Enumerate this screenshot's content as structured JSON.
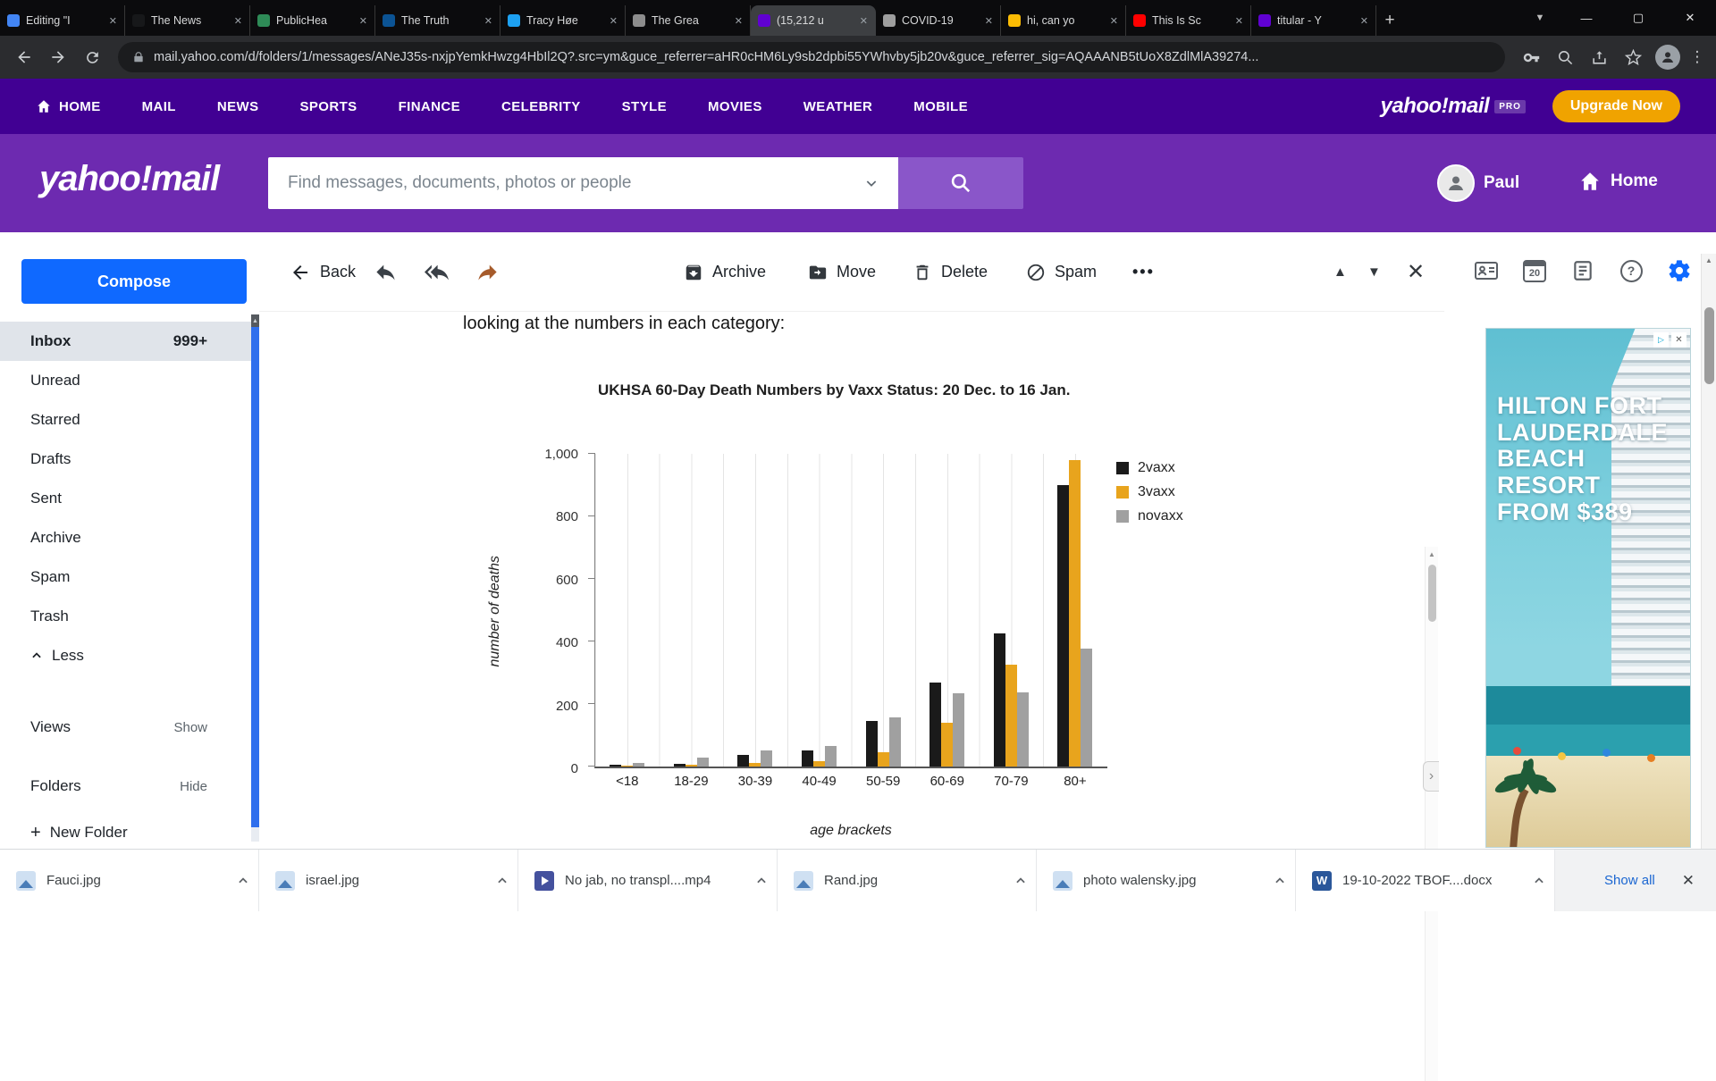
{
  "browser": {
    "tabs": [
      {
        "title": "Editing \"I",
        "color": "#4285f4",
        "active": false
      },
      {
        "title": "The News",
        "color": "#17181a",
        "active": false
      },
      {
        "title": "PublicHea",
        "color": "#2e8b57",
        "active": false
      },
      {
        "title": "The Truth",
        "color": "#0b5394",
        "active": false
      },
      {
        "title": "Tracy Høe",
        "color": "#1da1f2",
        "active": false
      },
      {
        "title": "The Grea",
        "color": "#8d8d8d",
        "active": false
      },
      {
        "title": "(15,212 u",
        "color": "#6001d2",
        "active": true
      },
      {
        "title": "COVID-19",
        "color": "#9e9e9e",
        "active": false
      },
      {
        "title": "hi, can yo",
        "color": "#fbbc04",
        "active": false
      },
      {
        "title": "This Is Sc",
        "color": "#ff0000",
        "active": false
      },
      {
        "title": "titular - Y",
        "color": "#6001d2",
        "active": false
      }
    ],
    "url": "mail.yahoo.com/d/folders/1/messages/ANeJ35s-nxjpYemkHwzg4HbIl2Q?.src=ym&guce_referrer=aHR0cHM6Ly9sb2dpbi55YWhvby5jb20v&guce_referrer_sig=AQAAANB5tUoX8ZdlMlA39274..."
  },
  "yahoo_nav": {
    "items": [
      "HOME",
      "MAIL",
      "NEWS",
      "SPORTS",
      "FINANCE",
      "CELEBRITY",
      "STYLE",
      "MOVIES",
      "WEATHER",
      "MOBILE"
    ],
    "active": "MAIL",
    "brand": "yahoo!mail",
    "brand_badge": "PRO",
    "upgrade_label": "Upgrade Now"
  },
  "header": {
    "logo": "yahoo!mail",
    "search_placeholder": "Find messages, documents, photos or people",
    "user_name": "Paul",
    "home_label": "Home"
  },
  "sidebar": {
    "compose_label": "Compose",
    "folders": [
      {
        "label": "Inbox",
        "count": "999+",
        "selected": true
      },
      {
        "label": "Unread"
      },
      {
        "label": "Starred"
      },
      {
        "label": "Drafts"
      },
      {
        "label": "Sent"
      },
      {
        "label": "Archive"
      },
      {
        "label": "Spam"
      },
      {
        "label": "Trash"
      },
      {
        "label": "Less",
        "icon": "chevron-up"
      }
    ],
    "sections": [
      {
        "label": "Views",
        "action": "Show"
      },
      {
        "label": "Folders",
        "action": "Hide"
      },
      {
        "label": "New Folder"
      }
    ]
  },
  "toolbar": {
    "back_label": "Back",
    "actions": [
      {
        "label": "Archive"
      },
      {
        "label": "Move"
      },
      {
        "label": "Delete"
      },
      {
        "label": "Spam"
      }
    ],
    "more": "•••"
  },
  "rail": {
    "calendar_count": "20"
  },
  "email": {
    "intro_text": "looking at the numbers in each category:"
  },
  "chart_data": {
    "type": "bar",
    "title": "UKHSA 60-Day Death Numbers by Vaxx Status: 20 Dec. to 16 Jan.",
    "xlabel": "age brackets",
    "ylabel": "number of deaths",
    "categories": [
      "<18",
      "18-29",
      "30-39",
      "40-49",
      "50-59",
      "60-69",
      "70-79",
      "80+"
    ],
    "series": [
      {
        "name": "2vaxx",
        "color": "#1a1a1a",
        "values": [
          5,
          10,
          38,
          52,
          145,
          270,
          425,
          900
        ]
      },
      {
        "name": "3vaxx",
        "color": "#e8a41d",
        "values": [
          2,
          5,
          12,
          18,
          45,
          140,
          325,
          980
        ]
      },
      {
        "name": "novaxx",
        "color": "#a0a0a0",
        "values": [
          12,
          28,
          52,
          66,
          158,
          235,
          238,
          378
        ]
      }
    ],
    "ylim": [
      0,
      1000
    ],
    "yticks": [
      "0",
      "200",
      "400",
      "600",
      "800",
      "1,000"
    ],
    "legend_position": "right",
    "grid": "vertical"
  },
  "ad": {
    "lines": [
      "HILTON FORT",
      "LAUDERDALE",
      "BEACH",
      "RESORT",
      "FROM $389"
    ]
  },
  "downloads": {
    "items": [
      {
        "name": "Fauci.jpg",
        "type": "image"
      },
      {
        "name": "israel.jpg",
        "type": "image"
      },
      {
        "name": "No jab, no transpl....mp4",
        "type": "video"
      },
      {
        "name": "Rand.jpg",
        "type": "image"
      },
      {
        "name": "photo walensky.jpg",
        "type": "image"
      },
      {
        "name": "19-10-2022 TBOF....docx",
        "type": "word"
      }
    ],
    "show_all_label": "Show all"
  }
}
